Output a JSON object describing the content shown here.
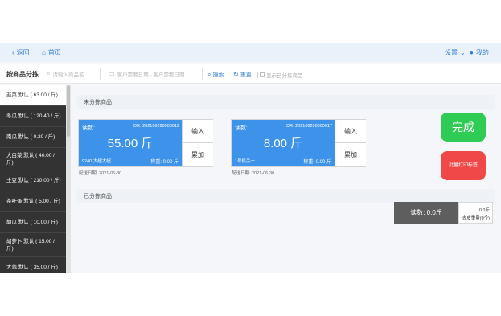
{
  "nav": {
    "back_label": "返回",
    "home_label": "首页",
    "settings_label": "设置",
    "mine_label": "我的"
  },
  "filter": {
    "title": "按商品分拣",
    "search_placeholder": "请输入商品名",
    "date_placeholder": "客户需要日期 - 客户需要日期",
    "query_label": "搜索",
    "reset_label": "重置",
    "show_sorted_label": "显示已分拣商品"
  },
  "sidebar": {
    "items": [
      {
        "label": "韭菜 默认 ( 63.00 / 斤)",
        "active": true
      },
      {
        "label": "冬瓜 默认 ( 120.40 / 斤)",
        "active": false
      },
      {
        "label": "南瓜 默认 ( 0.20 / 斤)",
        "active": false
      },
      {
        "label": "大白菜 默认 ( 40.00 / 斤)",
        "active": false
      },
      {
        "label": "土豆 默认 ( 210.00 / 斤)",
        "active": false
      },
      {
        "label": "茶叶蛋 默认 ( 5.00 / 斤)",
        "active": false
      },
      {
        "label": "胡瓜 默认 ( 10.00 / 斤)",
        "active": false
      },
      {
        "label": "胡萝卜 默认 ( 15.00 / 斤)",
        "active": false
      },
      {
        "label": "大蒜 默认 ( 35.00 / 斤)",
        "active": false
      }
    ]
  },
  "sections": {
    "unsorted_title": "未分拣商品",
    "sorted_title": "已分拣商品"
  },
  "cards": [
    {
      "reading_label": "读数:",
      "order_code": "DR: 202106290000012",
      "weight": "55.00 斤",
      "customer": "9240 大超大超",
      "sorted_text": "称重: 0.00 斤",
      "input_label": "输入",
      "add_label": "累加",
      "delivery_date": "配送日期: 2021-06-30"
    },
    {
      "reading_label": "读数:",
      "order_code": "DR: 202106290000017",
      "weight": "8.00 斤",
      "customer": "1号机关一",
      "sorted_text": "称重: 0.00 斤",
      "input_label": "输入",
      "add_label": "累加",
      "delivery_date": "配送日期: 2021-06-30"
    }
  ],
  "actions": {
    "done_label": "完成",
    "batch_print_label": "批量打印标签"
  },
  "scale": {
    "reading": "读数: 0.0斤",
    "tare_value": "0.0斤",
    "tare_label": "去皮重量(0个)"
  },
  "colors": {
    "primary": "#3d93ea",
    "success": "#2ecc55",
    "danger": "#f04848",
    "sidebar_bg": "#333333"
  }
}
